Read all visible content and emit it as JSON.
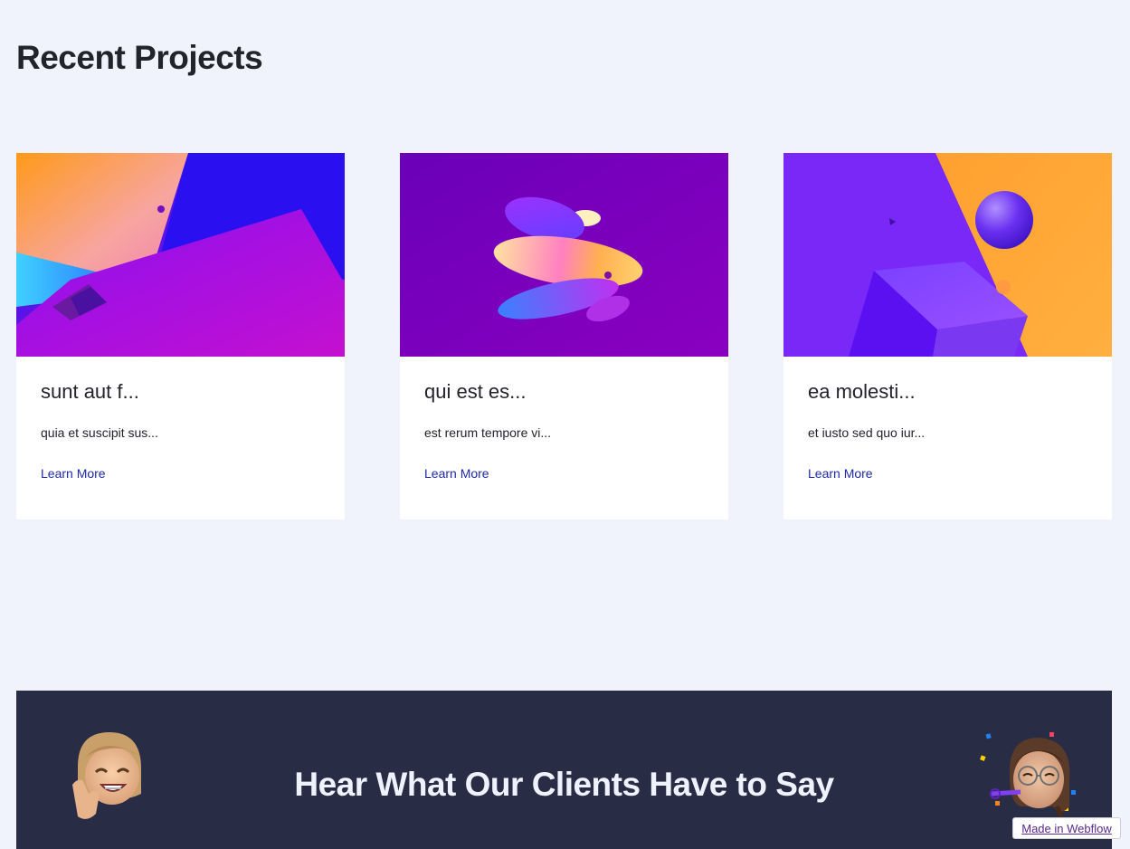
{
  "section": {
    "title": "Recent Projects"
  },
  "cards": [
    {
      "title": "sunt aut f...",
      "excerpt": "quia et suscipit sus...",
      "link_label": "Learn More",
      "image": "abstract-3d-gradient-planes"
    },
    {
      "title": "qui est es...",
      "excerpt": "est rerum tempore vi...",
      "link_label": "Learn More",
      "image": "abstract-3d-floating-discs"
    },
    {
      "title": "ea molesti...",
      "excerpt": "et iusto sed quo iur...",
      "link_label": "Learn More",
      "image": "abstract-3d-cube-sphere"
    }
  ],
  "testimonials": {
    "title": "Hear What Our Clients Have to Say",
    "avatars": [
      "memoji-peace-sign",
      "memoji-party-glasses"
    ]
  },
  "badge": {
    "label": "Made in Webflow"
  },
  "colors": {
    "page_background": "#f0f3fb",
    "link": "#1e2aa8",
    "banner_background": "#282d45",
    "heading": "#23232b"
  }
}
